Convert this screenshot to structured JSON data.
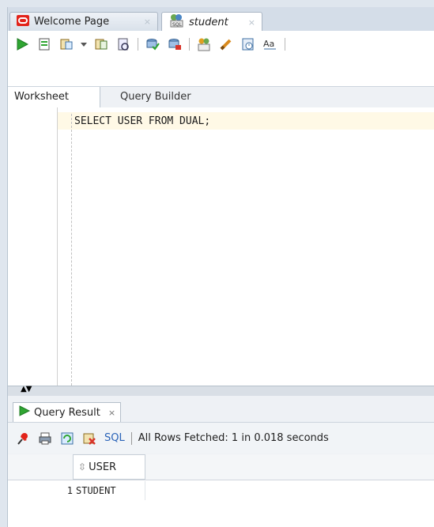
{
  "tabs": [
    {
      "label": "Welcome Page",
      "close": "×",
      "icon": "oracle-logo-icon"
    },
    {
      "label": "student",
      "close": "×",
      "icon": "sql-connection-icon"
    }
  ],
  "toolbar": {
    "icons": [
      "run-statement-icon",
      "run-script-icon",
      "explain-plan-icon",
      "dropdown-icon",
      "autotrace-icon",
      "sql-tuning-icon",
      "commit-icon",
      "rollback-icon",
      "unshared-worksheet-icon",
      "clear-icon",
      "history-icon",
      "to-upper-lower-icon"
    ]
  },
  "subtabs": {
    "worksheet": "Worksheet",
    "query_builder": "Query Builder"
  },
  "editor": {
    "code": "SELECT USER FROM DUAL;"
  },
  "results": {
    "tab_label": "Query Result",
    "tab_close": "×",
    "sql_link": "SQL",
    "status": "All Rows Fetched: 1 in 0.018 seconds",
    "columns": [
      "USER"
    ],
    "rows": [
      {
        "num": "1",
        "values": [
          "STUDENT"
        ]
      }
    ]
  },
  "colors": {
    "accent": "#2a63b8",
    "run_green": "#2fa532",
    "oracle_red": "#e2231a"
  }
}
